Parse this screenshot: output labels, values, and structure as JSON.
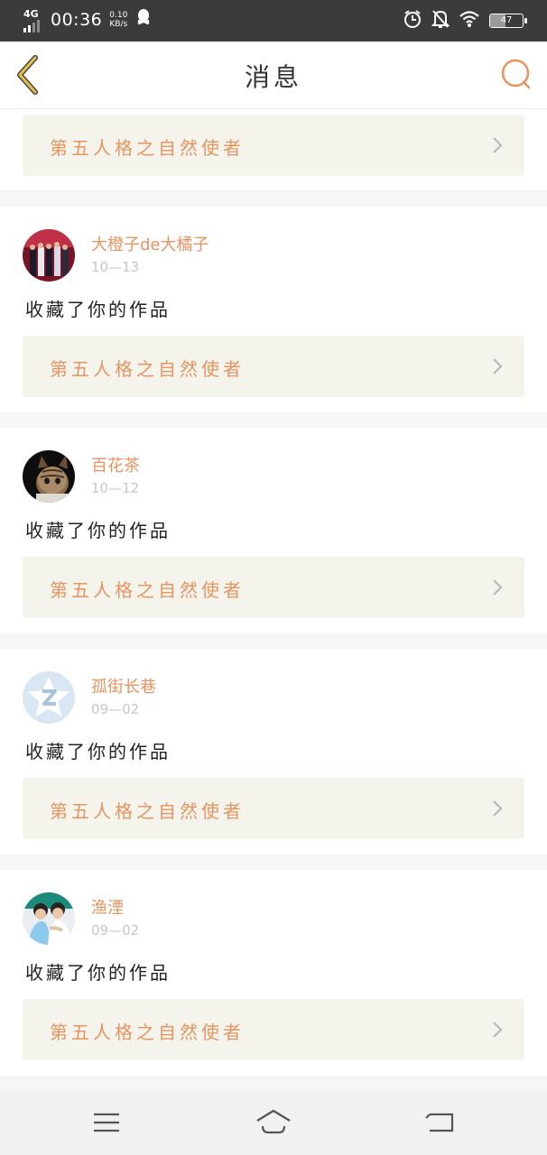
{
  "status_bar": {
    "network": "4G",
    "time": "00:36",
    "speed_value": "0.10",
    "speed_unit": "KB/s",
    "battery": "47",
    "battery_level": 0.47
  },
  "header": {
    "title": "消息",
    "back_icon": "chevron-left-icon",
    "search_icon": "search-icon"
  },
  "colors": {
    "accent": "#e8945f",
    "back_chevron": "#e7c24a",
    "card_bg": "#f4f4ed"
  },
  "top_card": {
    "work_title": "第五人格之自然使者"
  },
  "notifications": [
    {
      "username": "大橙子de大橘子",
      "date": "10—13",
      "action": "收藏了你的作品",
      "work_title": "第五人格之自然使者"
    },
    {
      "username": "百花茶",
      "date": "10—12",
      "action": "收藏了你的作品",
      "work_title": "第五人格之自然使者"
    },
    {
      "username": "孤街长巷",
      "date": "09—02",
      "action": "收藏了你的作品",
      "work_title": "第五人格之自然使者"
    },
    {
      "username": "渔湮",
      "date": "09—02",
      "action": "收藏了你的作品",
      "work_title": "第五人格之自然使者"
    }
  ],
  "nav_bar": {
    "menu_icon": "menu-icon",
    "home_icon": "home-icon",
    "back_icon": "back-icon"
  }
}
